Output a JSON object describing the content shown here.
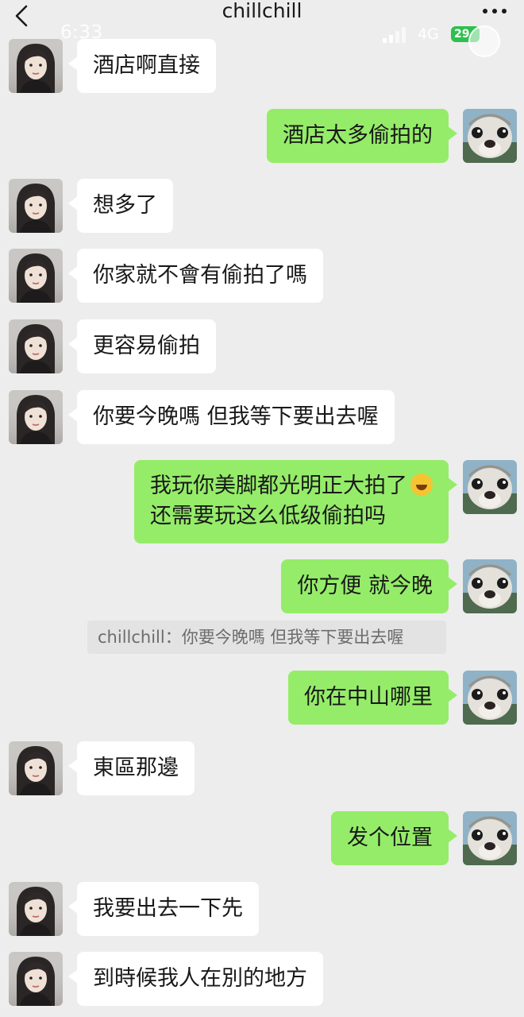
{
  "status_bar": {
    "time": "6:33",
    "network": "4G",
    "battery": "29"
  },
  "header": {
    "title": "chillchill"
  },
  "messages": [
    {
      "side": "in",
      "text": "酒店啊直接"
    },
    {
      "side": "out",
      "text": "酒店太多偷拍的"
    },
    {
      "side": "in",
      "text": "想多了"
    },
    {
      "side": "in",
      "text": "你家就不會有偷拍了嗎"
    },
    {
      "side": "in",
      "text": "更容易偷拍"
    },
    {
      "side": "in",
      "text": "你要今晚嗎 但我等下要出去喔"
    },
    {
      "side": "out",
      "line1": "我玩你美脚都光明正大拍了",
      "line2": "还需要玩这么低级偷拍吗",
      "emoji": "rolling-on-floor-laughing"
    },
    {
      "side": "out",
      "text": "你方便 就今晚"
    },
    {
      "side": "out",
      "text": "你在中山哪里"
    },
    {
      "side": "in",
      "text": "東區那邊"
    },
    {
      "side": "out",
      "text": "发个位置"
    },
    {
      "side": "in",
      "text": "我要出去一下先"
    },
    {
      "side": "in",
      "text": "到時候我人在別的地方"
    }
  ],
  "quote": {
    "text": "chillchill：你要今晚嗎 但我等下要出去喔"
  },
  "colors": {
    "background": "#ededed",
    "incoming_bubble": "#ffffff",
    "outgoing_bubble": "#95ec69"
  }
}
